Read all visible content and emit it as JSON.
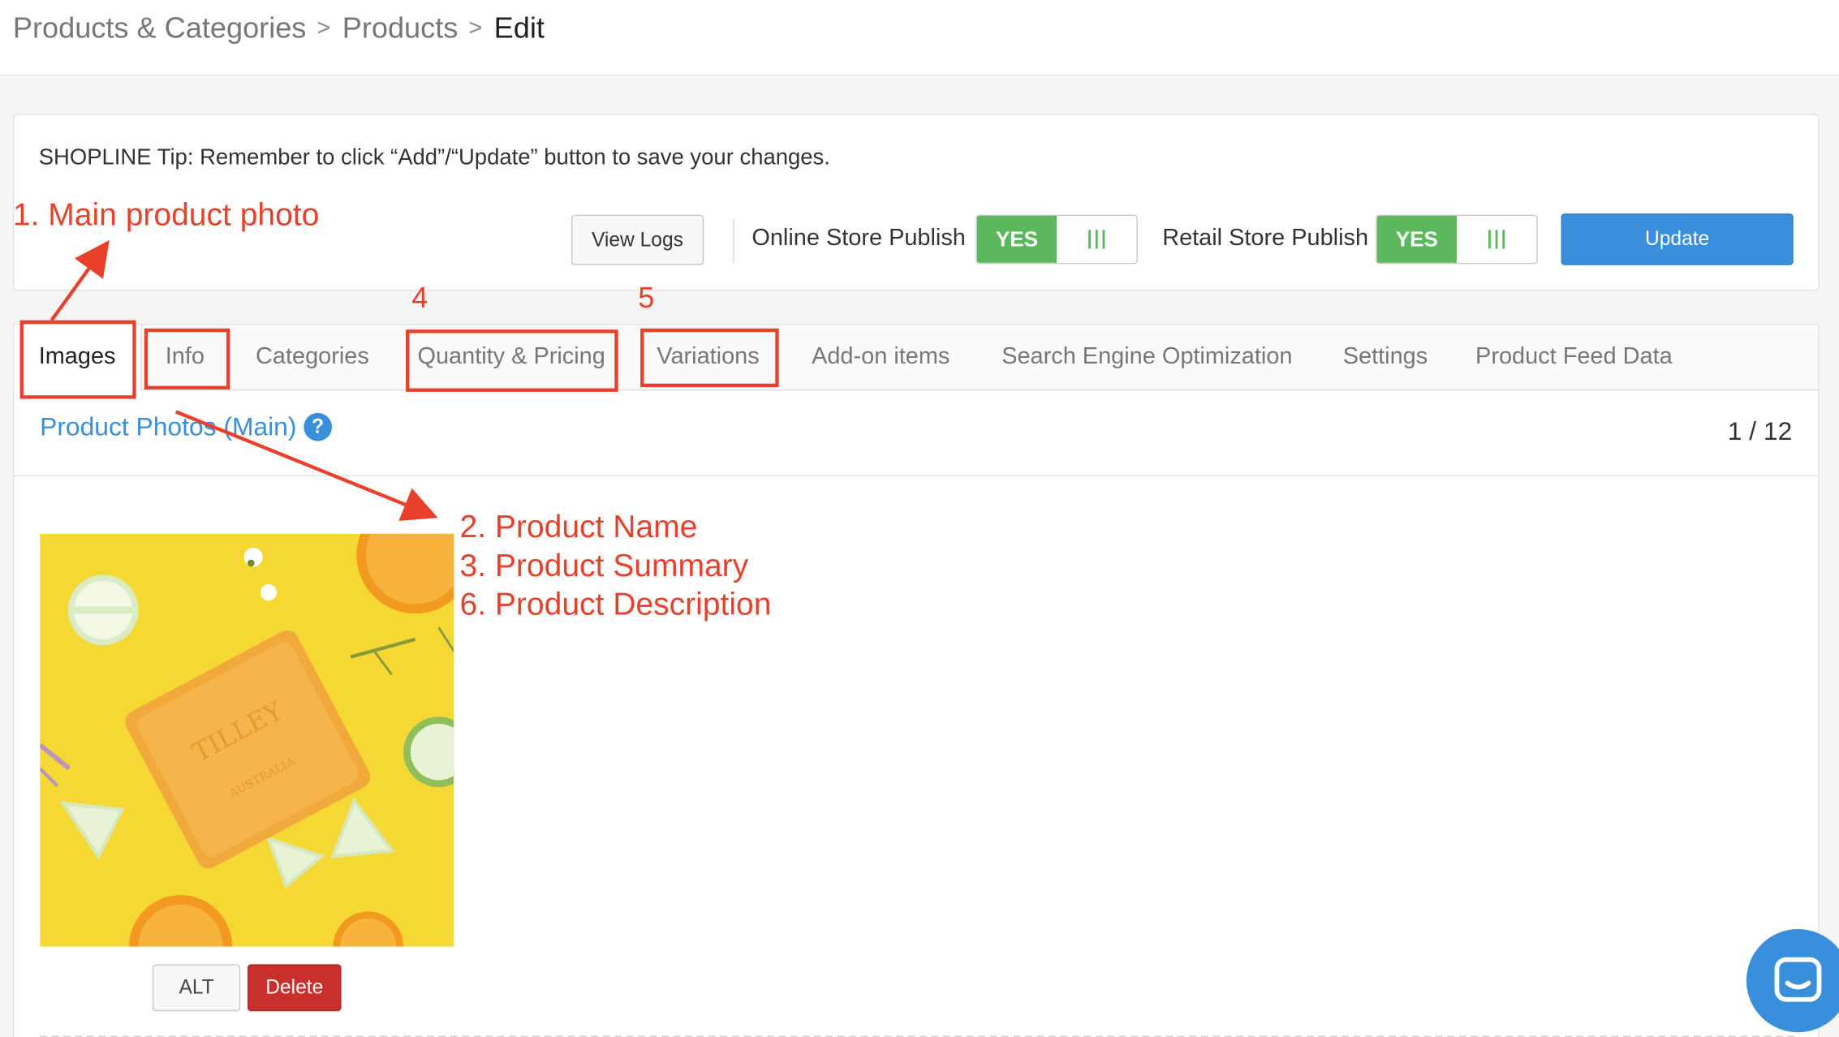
{
  "breadcrumb": {
    "items": [
      "Products & Categories",
      "Products",
      "Edit"
    ]
  },
  "tip": {
    "text": "SHOPLINE Tip: Remember to click “Add”/“Update” button to save your changes."
  },
  "toolbar": {
    "view_logs_label": "View Logs",
    "online_store_label": "Online Store Publish",
    "online_store_value": "YES",
    "retail_store_label": "Retail Store Publish",
    "retail_store_value": "YES",
    "update_label": "Update"
  },
  "tabs": {
    "images": "Images",
    "info": "Info",
    "categories": "Categories",
    "quantity_pricing": "Quantity & Pricing",
    "variations": "Variations",
    "addon_items": "Add-on items",
    "seo": "Search Engine Optimization",
    "settings": "Settings",
    "product_feed": "Product Feed Data"
  },
  "photos": {
    "title": "Product Photos (Main)",
    "help_symbol": "?",
    "counter": "1 / 12",
    "alt_label": "ALT",
    "delete_label": "Delete"
  },
  "annotations": {
    "main_photo": "1. Main product photo",
    "num4": "4",
    "num5": "5",
    "product_name": "2. Product Name",
    "product_summary": "3. Product Summary",
    "product_description": "6. Product Description"
  },
  "colors": {
    "accent_blue": "#3a8fdc",
    "toggle_green": "#5cb85c",
    "delete_red": "#c9302c",
    "annotation_red": "#e8402b"
  },
  "icons": {
    "breadcrumb_separator": "chevron-right-icon",
    "help": "question-circle-icon",
    "chat": "chat-bubble-icon"
  }
}
